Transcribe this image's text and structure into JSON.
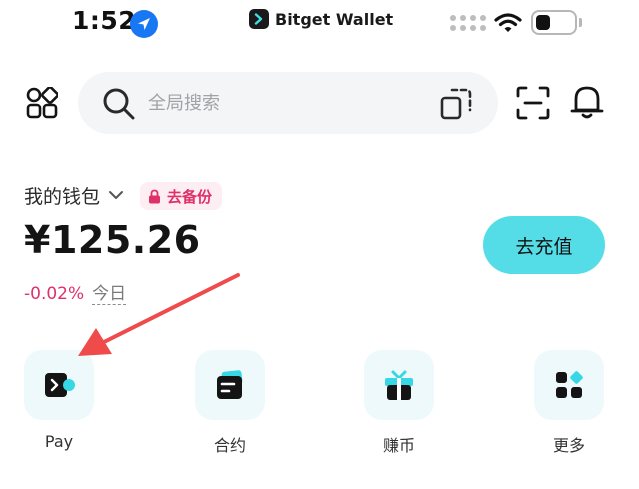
{
  "status_bar": {
    "time": "1:52",
    "app_title": "Bitget Wallet"
  },
  "header": {
    "search_placeholder": "全局搜索"
  },
  "wallet": {
    "name": "我的钱包",
    "backup_label": "去备份",
    "balance": "¥125.26",
    "change_percent": "-0.02%",
    "change_period": "今日",
    "recharge_label": "去充值"
  },
  "actions": [
    {
      "label": "Pay",
      "icon": "pay-icon"
    },
    {
      "label": "合约",
      "icon": "contract-icon"
    },
    {
      "label": "赚币",
      "icon": "gift-icon"
    },
    {
      "label": "更多",
      "icon": "more-grid-icon"
    }
  ],
  "colors": {
    "accent": "#55dde7",
    "negative": "#e0306a",
    "tile_bg": "#eef9fb",
    "annotation_arrow": "#ef4b4b"
  }
}
